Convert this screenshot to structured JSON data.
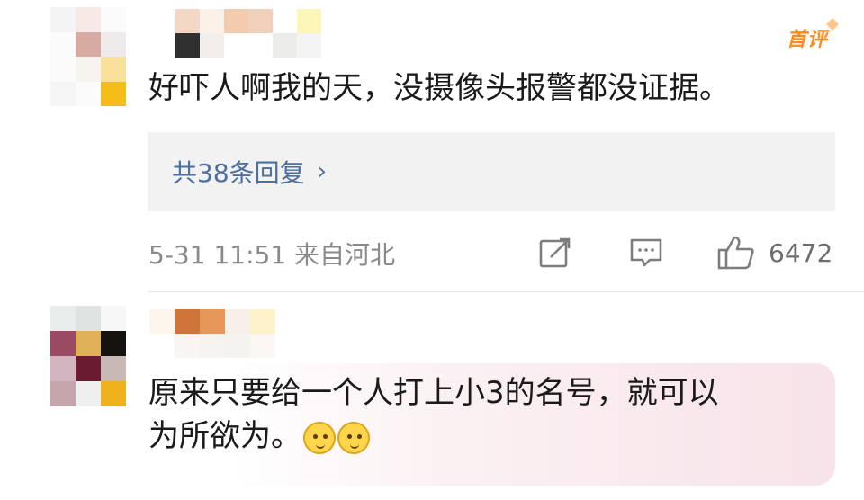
{
  "comments": [
    {
      "badge": "首评",
      "text": "好吓人啊我的天，没摄像头报警都没证据。",
      "reply_label": "共38条回复",
      "reply_chevron": "›",
      "meta": "5-31 11:51 来自河北",
      "likes": "6472"
    },
    {
      "text_line1": "原来只要给一个人打上小3的名号，就可以",
      "text_line2": "为所欲为。"
    }
  ],
  "avatar1_colors": [
    "#f4f4f4",
    "#f7e9e6",
    "#fbfbfb",
    "#fbfbfb",
    "#d6aba1",
    "#efeaea",
    "#fbfbfb",
    "#f7f4ef",
    "#f8e29b",
    "#f5f5f5",
    "#fbfbfb",
    "#f4bd17"
  ],
  "name1_colors": [
    "#ffffff",
    "#f4d7c4",
    "#f9f1ea",
    "#f3ccb0",
    "#f1d1b9",
    "#ffffff",
    "#f9f6b8",
    "#ffffff",
    "#303030",
    "#f2eee9",
    "#ffffff",
    "#ffffff",
    "#ebebe9",
    "#f4f4f4"
  ],
  "avatar2_colors": [
    "#e9ecec",
    "#dfe3e2",
    "#f7f7f7",
    "#9a4a62",
    "#e1b15a",
    "#15120f",
    "#d1b4bf",
    "#6b1b31",
    "#c8b9b4",
    "#c6a4ac",
    "#efefef",
    "#eeb21c"
  ],
  "name2_colors": [
    "#fdf6ee",
    "#d0753a",
    "#e8975a",
    "#f7f0ea",
    "#fdf1c9",
    "#ffffff",
    "#ffffff",
    "#f8f5f2",
    "#f6f4f0",
    "#f5f3ef",
    "#fbf8f4",
    "#ffffff"
  ],
  "icons": {
    "share": "share-icon",
    "comment": "comment-icon",
    "like": "thumbs-up-icon",
    "emoji": "thinking-face-emoji"
  },
  "colors": {
    "link": "#4b6fa0",
    "badge": "#ff8a1e",
    "meta": "#8a8a8a"
  }
}
